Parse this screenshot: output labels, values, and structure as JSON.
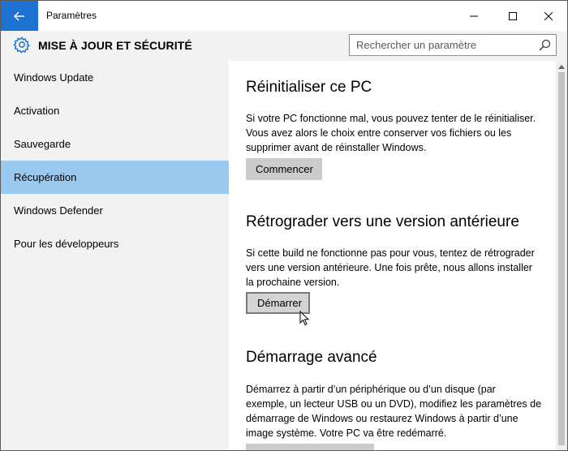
{
  "window": {
    "title": "Paramètres"
  },
  "header": {
    "title": "MISE À JOUR ET SÉCURITÉ"
  },
  "search": {
    "placeholder": "Rechercher un paramètre"
  },
  "sidebar": {
    "items": [
      {
        "label": "Windows Update"
      },
      {
        "label": "Activation"
      },
      {
        "label": "Sauvegarde"
      },
      {
        "label": "Récupération",
        "active": true
      },
      {
        "label": "Windows Defender"
      },
      {
        "label": "Pour les développeurs"
      }
    ]
  },
  "sections": [
    {
      "title": "Réinitialiser ce PC",
      "lines": [
        "Si votre PC fonctionne mal, vous pouvez tenter de le réinitialiser.",
        "Vous avez alors le choix entre conserver vos fichiers ou les",
        "supprimer avant de réinstaller Windows."
      ],
      "button": "Commencer"
    },
    {
      "title": "Rétrograder vers une version antérieure",
      "lines": [
        "Si cette build ne fonctionne pas pour vous, tentez de rétrograder",
        "vers une version antérieure. Une fois prête, nous allons installer",
        "la prochaine version."
      ],
      "button": "Démarrer"
    },
    {
      "title": "Démarrage avancé",
      "lines": [
        "Démarrez à partir d’un périphérique ou d’un disque (par",
        "exemple, un lecteur USB ou un DVD), modifiez les paramètres de",
        "démarrage de Windows ou restaurez Windows à partir d’une",
        "image système. Votre PC va être redémarré."
      ]
    }
  ],
  "colors": {
    "accent": "#1e73d2",
    "active_nav": "#99c9ef",
    "sidebar_bg": "#f2f2f2",
    "button_bg": "#cccccc"
  }
}
